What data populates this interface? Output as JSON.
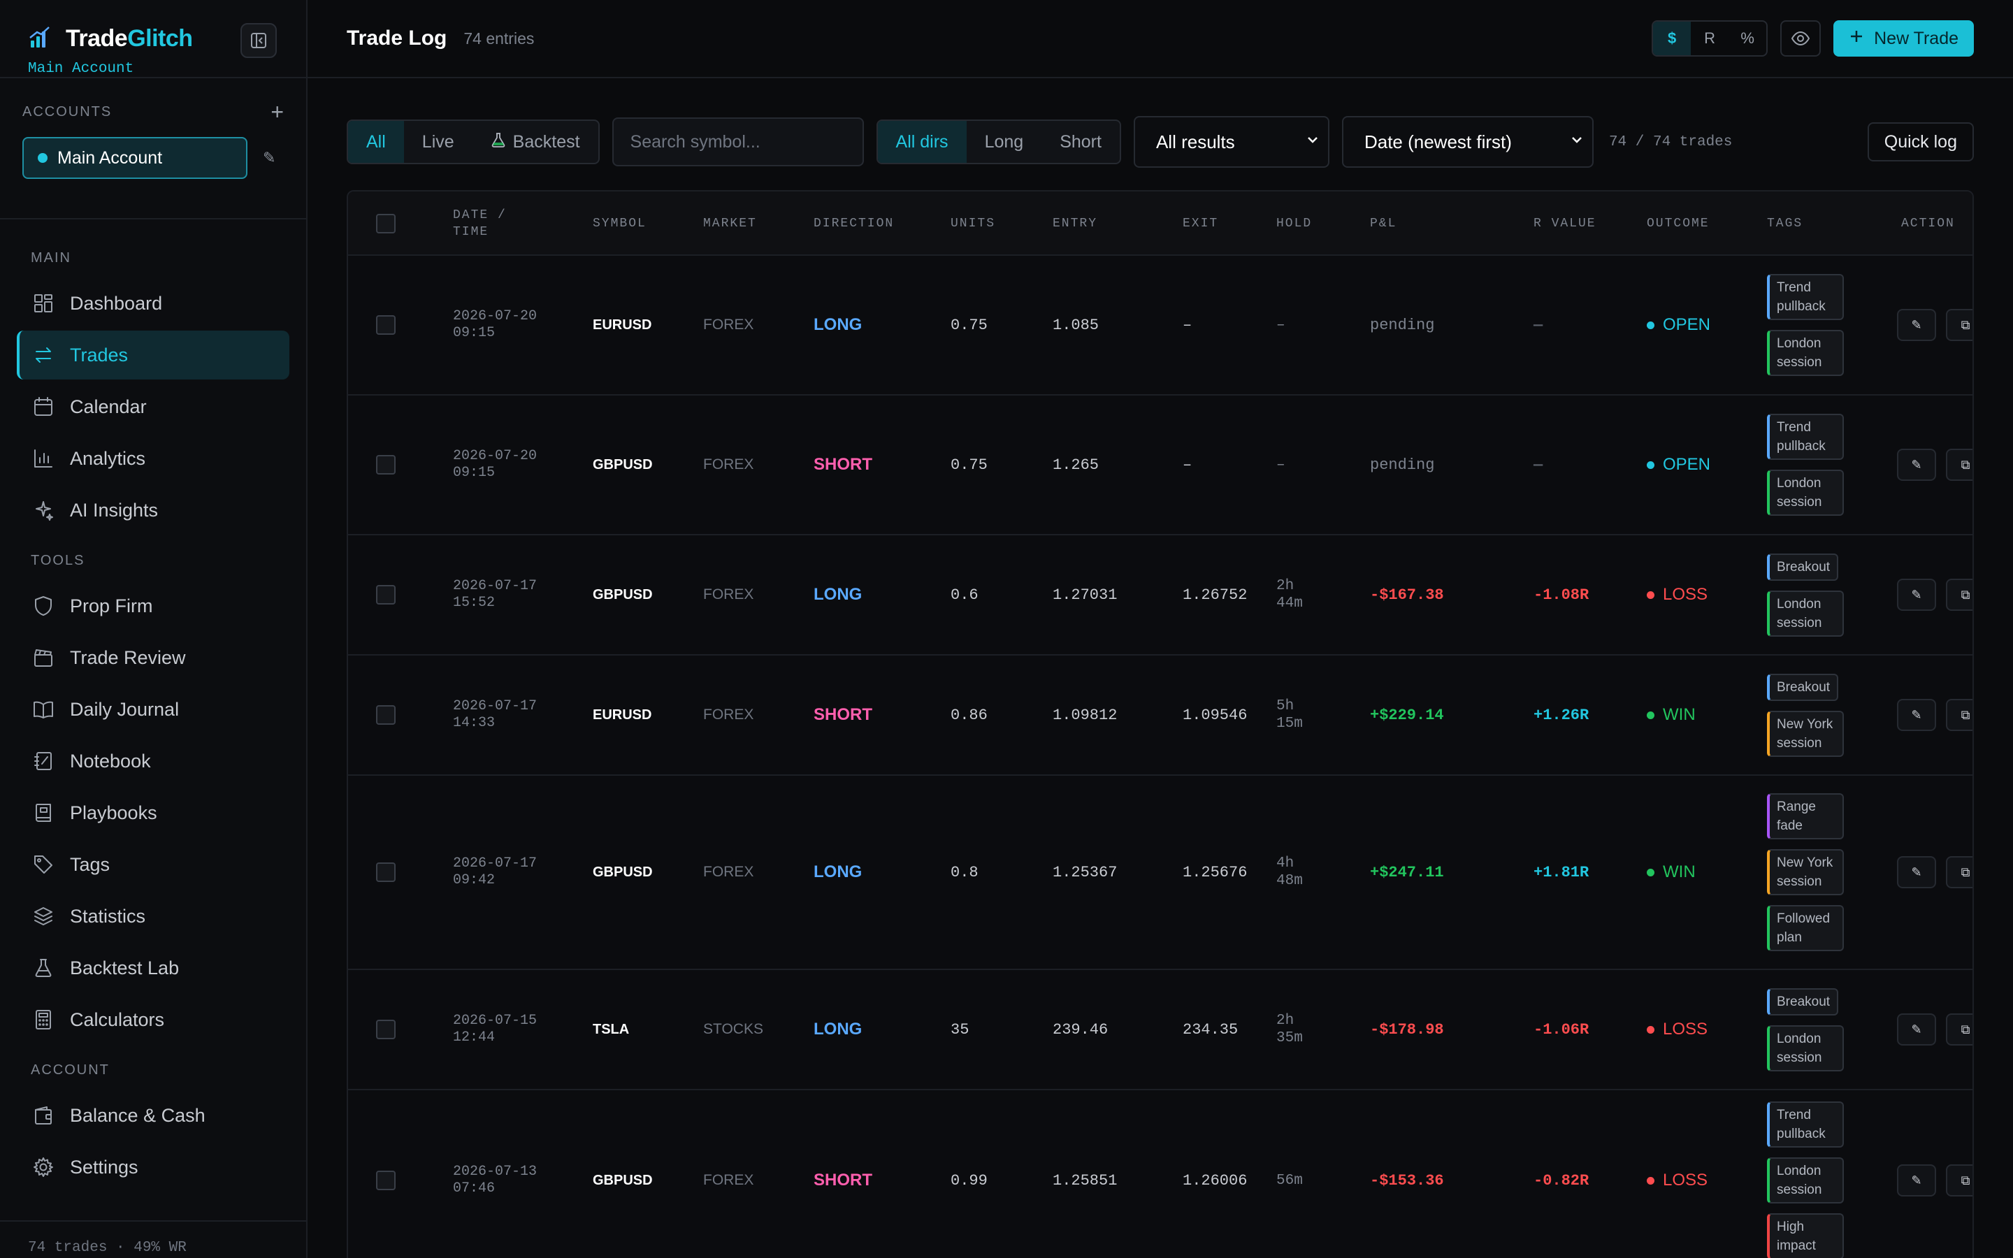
{
  "brand": {
    "name_a": "Trade",
    "name_b": "Glitch",
    "account_label": "Main Account"
  },
  "accounts": {
    "heading": "ACCOUNTS",
    "add_glyph": "+",
    "selected": "Main Account",
    "edit_glyph": "✎"
  },
  "nav": {
    "main_heading": "MAIN",
    "main_items": [
      {
        "label": "Dashboard",
        "icon": "grid-icon"
      },
      {
        "label": "Trades",
        "icon": "arrows-swap-icon",
        "active": true
      },
      {
        "label": "Calendar",
        "icon": "calendar-icon"
      },
      {
        "label": "Analytics",
        "icon": "bar-chart-icon"
      },
      {
        "label": "AI Insights",
        "icon": "sparkle-icon"
      }
    ],
    "tools_heading": "TOOLS",
    "tools_items": [
      {
        "label": "Prop Firm",
        "icon": "shield-icon"
      },
      {
        "label": "Trade Review",
        "icon": "clapperboard-icon"
      },
      {
        "label": "Daily Journal",
        "icon": "book-open-icon"
      },
      {
        "label": "Notebook",
        "icon": "notebook-icon"
      },
      {
        "label": "Playbooks",
        "icon": "book-icon"
      },
      {
        "label": "Tags",
        "icon": "tag-icon"
      },
      {
        "label": "Statistics",
        "icon": "layers-icon"
      },
      {
        "label": "Backtest Lab",
        "icon": "flask-icon"
      },
      {
        "label": "Calculators",
        "icon": "calculator-icon"
      }
    ],
    "account_heading": "ACCOUNT",
    "account_items": [
      {
        "label": "Balance & Cash",
        "icon": "wallet-icon"
      },
      {
        "label": "Settings",
        "icon": "gear-icon"
      }
    ],
    "footer": "74 trades · 49% WR"
  },
  "header": {
    "title": "Trade Log",
    "entries": "74 entries",
    "units": [
      "$",
      "R",
      "%"
    ],
    "unit_selected": "$",
    "new_trade": "New Trade"
  },
  "filters": {
    "source": [
      "All",
      "Live",
      "Backtest"
    ],
    "source_selected": "All",
    "search_placeholder": "Search symbol...",
    "direction": [
      "All dirs",
      "Long",
      "Short"
    ],
    "direction_selected": "All dirs",
    "result_select": "All results",
    "sort_select": "Date (newest first)",
    "count": "74 / 74 trades",
    "quick_log": "Quick log"
  },
  "columns": [
    "DATE / TIME",
    "SYMBOL",
    "MARKET",
    "DIRECTION",
    "UNITS",
    "ENTRY",
    "EXIT",
    "HOLD",
    "P&L",
    "R VALUE",
    "OUTCOME",
    "TAGS",
    "ACTION"
  ],
  "colors": {
    "accent": "#22c7e0",
    "long": "#5aa9ff",
    "short": "#ff5fae",
    "profit": "#22c55e",
    "loss": "#ff4d4f",
    "tag_blue": "#5aa9ff",
    "tag_green": "#22c55e",
    "tag_orange": "#f5a524",
    "tag_purple": "#a855f7",
    "tag_red": "#ef4444"
  },
  "trades": [
    {
      "date": "2026-07-20",
      "time": "09:15",
      "symbol": "EURUSD",
      "market": "FOREX",
      "direction": "LONG",
      "units": "0.75",
      "entry": "1.085",
      "exit": "–",
      "hold": "–",
      "pnl": "pending",
      "r": "—",
      "outcome": "OPEN",
      "tags": [
        {
          "text": "Trend pullback",
          "color": "blue"
        },
        {
          "text": "London session",
          "color": "green"
        }
      ]
    },
    {
      "date": "2026-07-20",
      "time": "09:15",
      "symbol": "GBPUSD",
      "market": "FOREX",
      "direction": "SHORT",
      "units": "0.75",
      "entry": "1.265",
      "exit": "–",
      "hold": "–",
      "pnl": "pending",
      "r": "—",
      "outcome": "OPEN",
      "tags": [
        {
          "text": "Trend pullback",
          "color": "blue"
        },
        {
          "text": "London session",
          "color": "green"
        }
      ]
    },
    {
      "date": "2026-07-17",
      "time": "15:52",
      "symbol": "GBPUSD",
      "market": "FOREX",
      "direction": "LONG",
      "units": "0.6",
      "entry": "1.27031",
      "exit": "1.26752",
      "hold": "2h 44m",
      "pnl": "-$167.38",
      "r": "-1.08R",
      "outcome": "LOSS",
      "tags": [
        {
          "text": "Breakout",
          "color": "blue"
        },
        {
          "text": "London session",
          "color": "green"
        }
      ]
    },
    {
      "date": "2026-07-17",
      "time": "14:33",
      "symbol": "EURUSD",
      "market": "FOREX",
      "direction": "SHORT",
      "units": "0.86",
      "entry": "1.09812",
      "exit": "1.09546",
      "hold": "5h 15m",
      "pnl": "+$229.14",
      "r": "+1.26R",
      "outcome": "WIN",
      "tags": [
        {
          "text": "Breakout",
          "color": "blue"
        },
        {
          "text": "New York session",
          "color": "orange"
        }
      ]
    },
    {
      "date": "2026-07-17",
      "time": "09:42",
      "symbol": "GBPUSD",
      "market": "FOREX",
      "direction": "LONG",
      "units": "0.8",
      "entry": "1.25367",
      "exit": "1.25676",
      "hold": "4h 48m",
      "pnl": "+$247.11",
      "r": "+1.81R",
      "outcome": "WIN",
      "tags": [
        {
          "text": "Range fade",
          "color": "purple"
        },
        {
          "text": "New York session",
          "color": "orange"
        },
        {
          "text": "Followed plan",
          "color": "green"
        }
      ]
    },
    {
      "date": "2026-07-15",
      "time": "12:44",
      "symbol": "TSLA",
      "market": "STOCKS",
      "direction": "LONG",
      "units": "35",
      "entry": "239.46",
      "exit": "234.35",
      "hold": "2h 35m",
      "pnl": "-$178.98",
      "r": "-1.06R",
      "outcome": "LOSS",
      "tags": [
        {
          "text": "Breakout",
          "color": "blue"
        },
        {
          "text": "London session",
          "color": "green"
        }
      ]
    },
    {
      "date": "2026-07-13",
      "time": "07:46",
      "symbol": "GBPUSD",
      "market": "FOREX",
      "direction": "SHORT",
      "units": "0.99",
      "entry": "1.25851",
      "exit": "1.26006",
      "hold": "56m",
      "pnl": "-$153.36",
      "r": "-0.82R",
      "outcome": "LOSS",
      "tags": [
        {
          "text": "Trend pullback",
          "color": "blue"
        },
        {
          "text": "London session",
          "color": "green"
        },
        {
          "text": "High impact",
          "color": "red"
        }
      ]
    }
  ]
}
